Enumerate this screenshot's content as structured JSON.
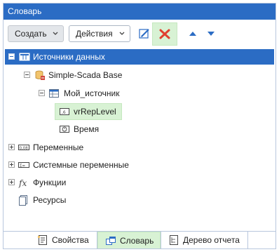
{
  "window": {
    "title": "Словарь"
  },
  "toolbar": {
    "create_label": "Создать",
    "actions_label": "Действия",
    "edit_icon": "edit-pencil-icon",
    "delete_icon": "delete-x-icon",
    "move_up_icon": "arrow-up-icon",
    "move_down_icon": "arrow-down-icon"
  },
  "tree": {
    "data_sources": "Источники данных",
    "database": "Simple-Scada Base",
    "source": "Мой_источник",
    "field_replevel": "vrRepLevel",
    "field_time": "Время",
    "variables": "Переменные",
    "system_variables": "Системные переменные",
    "functions": "Функции",
    "resources": "Ресурсы"
  },
  "tabs": {
    "properties": "Свойства",
    "dictionary": "Словарь",
    "report_tree": "Дерево отчета"
  },
  "colors": {
    "accent": "#2b6cc4",
    "highlight": "#d8f2d4",
    "delete_red": "#e0402f"
  }
}
